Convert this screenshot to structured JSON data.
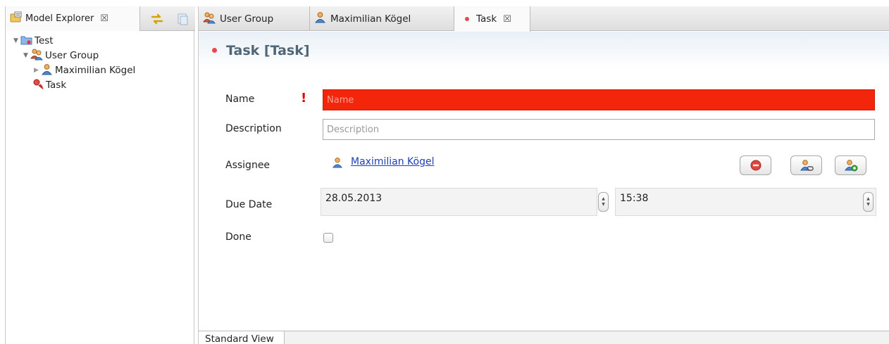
{
  "model_explorer": {
    "tab_label": "Model Explorer",
    "close_glyph": "☒",
    "tree": [
      {
        "label": "Test",
        "icon": "project-folder-icon",
        "expanded": true
      },
      {
        "label": "User Group",
        "icon": "user-group-icon",
        "expanded": true
      },
      {
        "label": "Maximilian Kögel",
        "icon": "user-icon",
        "expanded": false
      },
      {
        "label": "Task",
        "icon": "task-icon"
      }
    ]
  },
  "editor": {
    "tabs": [
      {
        "label": "User Group",
        "icon": "user-group-icon"
      },
      {
        "label": "Maximilian Kögel",
        "icon": "user-icon"
      },
      {
        "label": "Task",
        "icon": "task-icon",
        "active": true
      }
    ],
    "close_glyph": "☒",
    "header_title": "Task [Task]",
    "form": {
      "name_label": "Name",
      "name_placeholder": "Name",
      "name_value": "",
      "description_label": "Description",
      "description_placeholder": "Description",
      "description_value": "",
      "assignee_label": "Assignee",
      "assignee_value": "Maximilian Kögel",
      "due_date_label": "Due Date",
      "due_date_value": "28.05.2013",
      "due_time_value": "15:38",
      "done_label": "Done",
      "done_checked": false
    },
    "bottom_tab_label": "Standard View"
  },
  "colors": {
    "error_field": "#f3260c",
    "header_title": "#4f6679",
    "link": "#1d3fb8",
    "required_mark": "#e00000"
  }
}
